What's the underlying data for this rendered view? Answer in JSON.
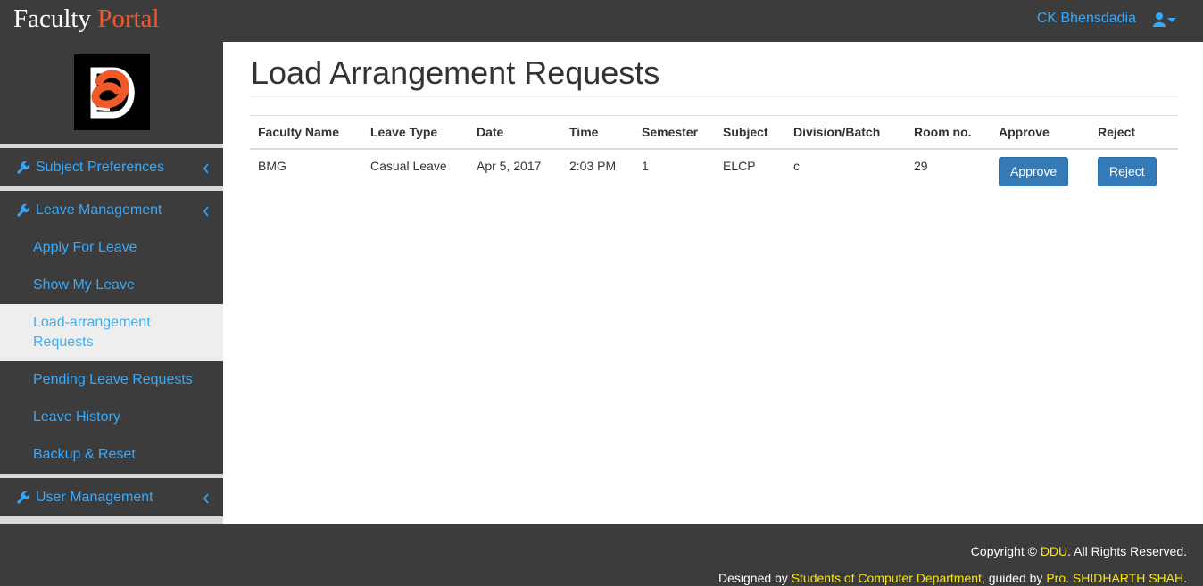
{
  "brand": {
    "part1": "Faculty",
    "part2": "Portal"
  },
  "user": {
    "name": "CK Bhensdadia",
    "icon": "user-caret-icon"
  },
  "sidebar": {
    "logo": "ddu-logo",
    "sections": [
      {
        "label": "Subject Preferences",
        "icon": "wrench-icon"
      },
      {
        "label": "Leave Management",
        "icon": "wrench-icon"
      },
      {
        "label": "User Management",
        "icon": "wrench-icon"
      }
    ],
    "leave_items": [
      {
        "label": "Apply For Leave"
      },
      {
        "label": "Show My Leave"
      },
      {
        "label": "Load-arrangement Requests",
        "line1": "Load-arrangement",
        "line2": "Requests",
        "active": true
      },
      {
        "label": "Pending Leave Requests"
      },
      {
        "label": "Leave History"
      },
      {
        "label": "Backup & Reset"
      }
    ]
  },
  "main": {
    "title": "Load Arrangement Requests",
    "table": {
      "headers": [
        "Faculty Name",
        "Leave Type",
        "Date",
        "Time",
        "Semester",
        "Subject",
        "Division/Batch",
        "Room no.",
        "Approve",
        "Reject"
      ],
      "rows": [
        {
          "faculty": "BMG",
          "leave_type": "Casual Leave",
          "date": "Apr 5, 2017",
          "time": "2:03 PM",
          "semester": "1",
          "subject": "ELCP",
          "division": "c",
          "room": "29",
          "approve_label": "Approve",
          "reject_label": "Reject"
        }
      ]
    }
  },
  "footer": {
    "copyright_prefix": "Copyright ©",
    "org": "DDU",
    "rights": ". All Rights Reserved.",
    "designed_by": "Designed by",
    "students": "Students of Computer Department",
    "guided_by": ", guided by",
    "guide": "Pro. SHIDHARTH SHAH",
    "end": "."
  },
  "colors": {
    "link": "#33aaff",
    "accent": "#f05a28",
    "button": "#337ab7",
    "footer_highlight": "#f5e614"
  }
}
